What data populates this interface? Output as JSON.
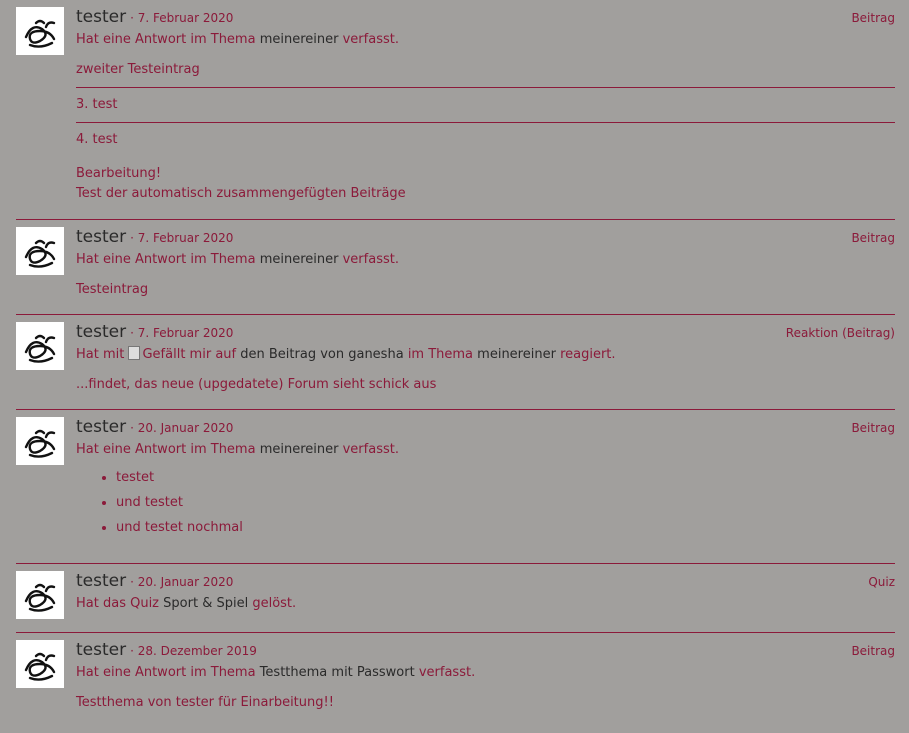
{
  "entries": [
    {
      "user": "tester",
      "date": "· 7. Februar 2020",
      "type": "Beitrag",
      "action": {
        "pre": "Hat eine Antwort im Thema",
        "topic": "meinereiner",
        "post": "verfasst."
      },
      "blocks": [
        "zweiter Testeintrag",
        "3. test",
        "4. test"
      ],
      "extra": [
        "Bearbeitung!",
        "Test der automatisch zusammengefügten Beiträge"
      ]
    },
    {
      "user": "tester",
      "date": "· 7. Februar 2020",
      "type": "Beitrag",
      "action": {
        "pre": "Hat eine Antwort im Thema",
        "topic": "meinereiner",
        "post": "verfasst."
      },
      "content": "Testeintrag"
    },
    {
      "user": "tester",
      "date": "· 7. Februar 2020",
      "type": "Reaktion (Beitrag)",
      "action": {
        "pre": "Hat mit",
        "img_alt": "Gefällt mir",
        "mid": "auf",
        "link": "den Beitrag von ganesha",
        "mid2": "im Thema",
        "topic": "meinereiner",
        "post": "reagiert."
      },
      "content": "...findet, das neue (upgedatete) Forum sieht schick aus"
    },
    {
      "user": "tester",
      "date": "· 20. Januar 2020",
      "type": "Beitrag",
      "action": {
        "pre": "Hat eine Antwort im Thema",
        "topic": "meinereiner",
        "post": "verfasst."
      },
      "list": [
        "testet",
        "und testet",
        "und testet nochmal"
      ]
    },
    {
      "user": "tester",
      "date": "· 20. Januar 2020",
      "type": "Quiz",
      "action": {
        "pre": "Hat das Quiz",
        "topic": "Sport & Spiel",
        "post": "gelöst."
      }
    },
    {
      "user": "tester",
      "date": "· 28. Dezember 2019",
      "type": "Beitrag",
      "action": {
        "pre": "Hat eine Antwort im Thema",
        "topic": "Testthema mit Passwort",
        "post": "verfasst."
      },
      "content": "Testthema von tester für Einarbeitung!!"
    }
  ]
}
